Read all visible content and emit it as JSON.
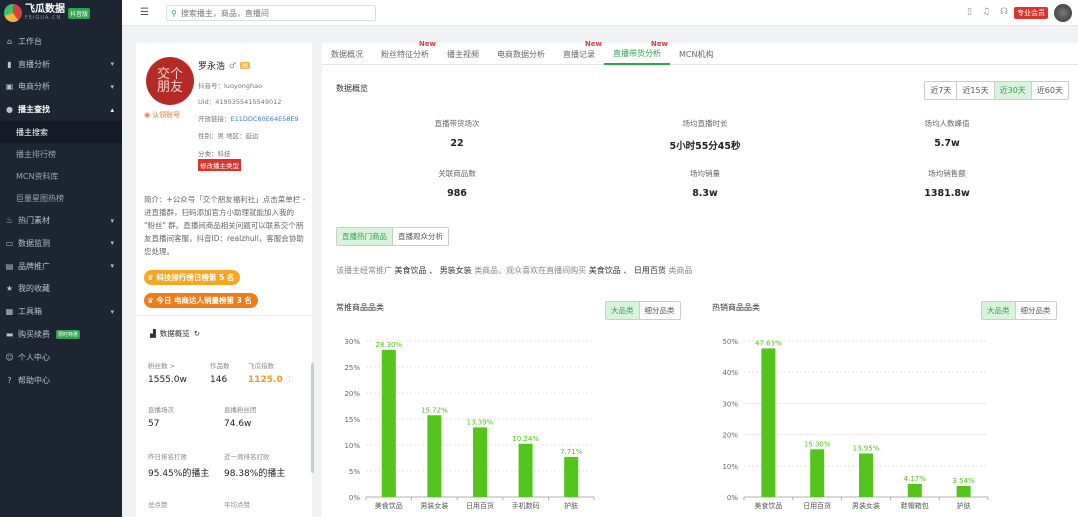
{
  "sidebar": {
    "logo_text": "飞瓜数据",
    "logo_sub": "FEIGUA.CN",
    "logo_badge": "抖音版",
    "items": [
      {
        "label": "工作台",
        "icon": "home-icon"
      },
      {
        "label": "直播分析",
        "icon": "chart-icon"
      },
      {
        "label": "电商分析",
        "icon": "cart-icon"
      },
      {
        "label": "播主查找",
        "icon": "search-icon"
      },
      {
        "label": "热门素材",
        "icon": "fire-icon"
      },
      {
        "label": "数据监测",
        "icon": "monitor-icon"
      },
      {
        "label": "品牌推广",
        "icon": "shop-icon"
      },
      {
        "label": "我的收藏",
        "icon": "star-icon"
      },
      {
        "label": "工具箱",
        "icon": "toolbox-icon"
      },
      {
        "label": "购买续费",
        "icon": "card-icon"
      },
      {
        "label": "个人中心",
        "icon": "user-icon"
      },
      {
        "label": "帮助中心",
        "icon": "help-icon"
      }
    ],
    "subitems": [
      "播主搜索",
      "播主排行榜",
      "MCN资料库",
      "巨量星图热榜"
    ],
    "buy_badge": "限时特惠"
  },
  "topbar": {
    "search_placeholder": "搜索播主，商品，直播间",
    "vip_label": "专业会员"
  },
  "profile": {
    "avatar_text": "交个朋友",
    "verified": "认领账号",
    "name": "罗永浩",
    "gender_glyph": "♂",
    "douyin_id": "抖音号：luoyonghao",
    "uid": "Uid：4195355415549012",
    "live_link_label": "开放链接：",
    "live_link_value": "E11DDC60E64E58E9",
    "gender_region": "性别：男   地区：延边",
    "category": "分类：科技",
    "change_type": "修改播主类型",
    "intro": "简介：+公众号「交个朋友福利社」点击菜单栏 - 进直播群，扫码添加官方小助理就能加入我的 \"粉丝\" 群。直播间商品相关问题可以联系交个朋友直播间客服，抖音ID：realzhull，客服会协助您处理。",
    "rank_tech": "科技排行榜日榜第 5 名",
    "rank_ecom": "今日 电商达人销量榜第 3 名",
    "overview_title": "数据概览",
    "stats": [
      {
        "label": "粉丝数 >",
        "value": "1555.0w"
      },
      {
        "label": "作品数",
        "value": "146"
      },
      {
        "label": "飞瓜指数",
        "value": "1125.0"
      },
      {
        "label": "直播场次",
        "value": "57"
      },
      {
        "label": "直播粉丝团",
        "value": "74.6w"
      },
      {
        "label": "昨日排名打败",
        "value": "95.45%的播主"
      },
      {
        "label": "近一周排名打败",
        "value": "98.38%的播主"
      },
      {
        "label": "总点赞",
        "value": ""
      },
      {
        "label": "平均点赞",
        "value": ""
      }
    ]
  },
  "tabs": [
    {
      "label": "数据概况",
      "new": false
    },
    {
      "label": "粉丝特征分析",
      "new": true
    },
    {
      "label": "播主视频",
      "new": false
    },
    {
      "label": "电商数据分析",
      "new": false
    },
    {
      "label": "直播记录",
      "new": true
    },
    {
      "label": "直播带货分析",
      "new": true
    },
    {
      "label": "MCN机构",
      "new": false
    }
  ],
  "new_label": "New",
  "overview": {
    "title": "数据概览",
    "ranges": [
      "近7天",
      "近15天",
      "近30天",
      "近60天"
    ],
    "metrics": [
      {
        "label": "直播带货场次",
        "value": "22"
      },
      {
        "label": "场均直播时长",
        "value": "5小时55分45秒"
      },
      {
        "label": "场均人数峰值",
        "value": "5.7w"
      },
      {
        "label": "关联商品数",
        "value": "986"
      },
      {
        "label": "场均销量",
        "value": "8.3w"
      },
      {
        "label": "场均销售额",
        "value": "1381.8w"
      }
    ]
  },
  "product_tabs": [
    "直播热门商品",
    "直播观众分析"
  ],
  "summary": {
    "p1": "该播主经常推广",
    "c1": "美食饮品 、 男装女装",
    "p2": "类商品，观众喜欢在直播间购买",
    "c2": "美食饮品 、 日用百货",
    "p3": "类商品"
  },
  "chart_toggle": [
    "大品类",
    "细分品类"
  ],
  "colors": {
    "accent": "#2fa44f",
    "bar": "#52c41a",
    "sidebar": "#1d2533"
  },
  "chart_data": [
    {
      "type": "bar",
      "title": "常推商品品类",
      "categories": [
        "美食饮品",
        "男装女装",
        "日用百货",
        "手机数码",
        "护肤"
      ],
      "values": [
        28.3,
        15.72,
        13.39,
        10.24,
        7.71
      ],
      "labels": [
        "28.30%",
        "15.72%",
        "13.39%",
        "10.24%",
        "7.71%"
      ],
      "yticks": [
        "0%",
        "5%",
        "10%",
        "15%",
        "20%",
        "25%",
        "30%"
      ],
      "ylim": [
        0,
        30
      ]
    },
    {
      "type": "bar",
      "title": "热销商品品类",
      "categories": [
        "美食饮品",
        "日用百货",
        "男装女装",
        "鞋帽箱包",
        "护肤"
      ],
      "values": [
        47.63,
        15.3,
        13.95,
        4.17,
        3.54
      ],
      "labels": [
        "47.63%",
        "15.30%",
        "13.95%",
        "4.17%",
        "3.54%"
      ],
      "yticks": [
        "0%",
        "10%",
        "20%",
        "30%",
        "40%",
        "50%"
      ],
      "ylim": [
        0,
        50
      ]
    }
  ]
}
